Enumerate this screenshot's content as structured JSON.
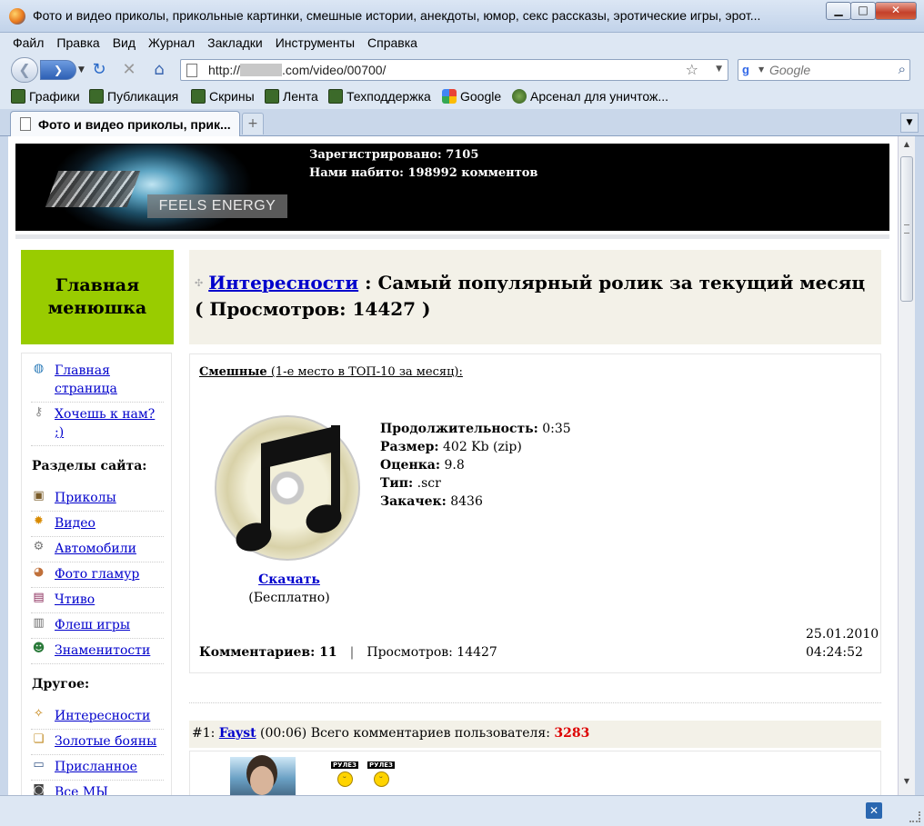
{
  "window": {
    "title": "Фото и видео приколы, прикольные картинки, смешные истории, анекдоты, юмор, секс рассказы, эротические игры, эрот...",
    "min": "▁",
    "max": "□",
    "close": "✕"
  },
  "menu": [
    "Файл",
    "Правка",
    "Вид",
    "Журнал",
    "Закладки",
    "Инструменты",
    "Справка"
  ],
  "nav": {
    "url_prefix": "http://",
    "url_suffix": ".com/video/00700/",
    "search_placeholder": "Google"
  },
  "bookmarks": [
    "Графики",
    "Публикация",
    "Скрины",
    "Лента",
    "Техподдержка",
    "Google",
    "Арсенал для уничтож..."
  ],
  "tab": {
    "label": "Фото и видео приколы, прик..."
  },
  "banner": {
    "logo_text": "FEELS ENERGY",
    "registered": "Зарегистрировано: 7105",
    "comments": "Нами набито: 198992 комментов"
  },
  "sidebar": {
    "menu_title": "Главная менюшка",
    "top_items": [
      {
        "label": "Главная страница",
        "icon": "globe-icon"
      },
      {
        "label": "Хочешь к нам? ;)",
        "icon": "key-icon"
      }
    ],
    "sections_title": "Разделы сайта:",
    "section_items": [
      {
        "label": "Приколы",
        "icon": "picture-icon"
      },
      {
        "label": "Видео",
        "icon": "gear-sun-icon"
      },
      {
        "label": "Автомобили",
        "icon": "cog-icon"
      },
      {
        "label": "Фото гламур",
        "icon": "palette-icon"
      },
      {
        "label": "Чтиво",
        "icon": "book-icon"
      },
      {
        "label": "Флеш игры",
        "icon": "cards-icon"
      },
      {
        "label": "Знаменитости",
        "icon": "people-icon"
      }
    ],
    "other_title": "Другое:",
    "other_items": [
      {
        "label": "Интересности",
        "icon": "magic-icon"
      },
      {
        "label": "Золотые бояны",
        "icon": "stack-icon"
      },
      {
        "label": "Присланное",
        "icon": "monitor-icon"
      },
      {
        "label": "Все МЫ",
        "icon": "camera-icon"
      }
    ]
  },
  "main": {
    "category_link": "Интересности",
    "heading_rest": " : Самый популярный ролик за текущий месяц ( Просмотров: 14427 )",
    "item": {
      "category": "Смешные",
      "rank_text": " (1-е место в ТОП-10 за месяц):",
      "download_label": "Скачать",
      "free_label": "(Бесплатно)",
      "duration_label": "Продолжительность:",
      "duration": " 0:35",
      "size_label": "Размер:",
      "size": " 402 Kb (zip)",
      "rating_label": "Оценка:",
      "rating": " 9.8",
      "type_label": "Тип:",
      "type": " .scr",
      "downloads_label": "Закачек:",
      "downloads": " 8436",
      "date": "25.01.2010",
      "time": "04:24:52",
      "comments_label": "Комментариев: 11",
      "views_label": "Просмотров: 14427"
    },
    "comment": {
      "number": "#1: ",
      "author": "Fayst",
      "time": " (00:06) Всего комментариев пользователя: ",
      "user_total": "3283",
      "badge": "РУЛЕЗ"
    }
  }
}
